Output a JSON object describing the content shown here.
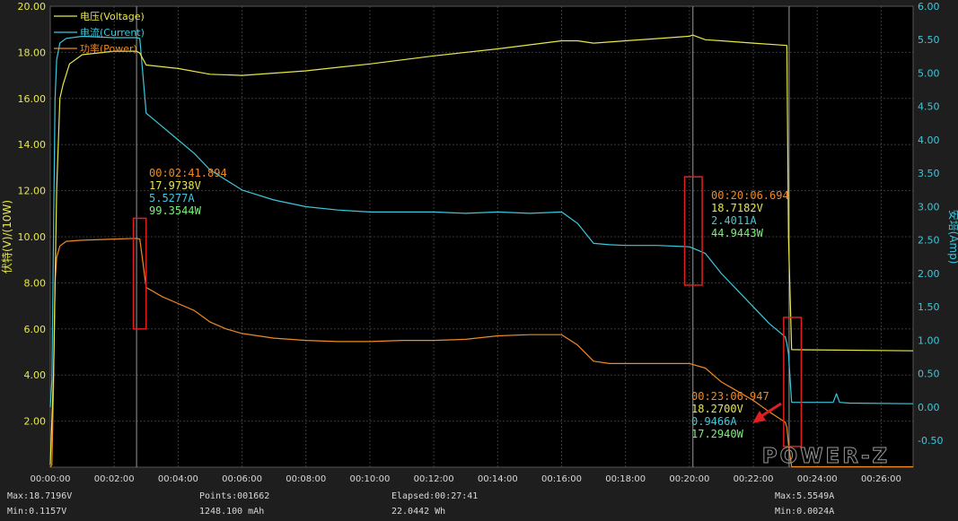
{
  "chart_data": {
    "type": "line",
    "ylabel_left": "伏特(V)/(10W)",
    "ylabel_right": "安培(Amp)",
    "y_left_lim": [
      0,
      20
    ],
    "y_left_ticks": [
      "2.00",
      "4.00",
      "6.00",
      "8.00",
      "10.00",
      "12.00",
      "14.00",
      "16.00",
      "18.00",
      "20.00"
    ],
    "y_right_lim": [
      -0.9,
      6.0
    ],
    "y_right_ticks": [
      "-0.50",
      "0.00",
      "0.50",
      "1.00",
      "1.50",
      "2.00",
      "2.50",
      "3.00",
      "3.50",
      "4.00",
      "4.50",
      "5.00",
      "5.50",
      "6.00"
    ],
    "x_lim_minutes": [
      0,
      27
    ],
    "x_ticks": [
      "00:00:00",
      "00:02:00",
      "00:04:00",
      "00:06:00",
      "00:08:00",
      "00:10:00",
      "00:12:00",
      "00:14:00",
      "00:16:00",
      "00:18:00",
      "00:20:00",
      "00:22:00",
      "00:24:00",
      "00:26:00"
    ],
    "grid": true,
    "legend_position": "top-left",
    "legend": [
      "电压(Voltage)",
      "电流(Current)",
      "功率(Power)"
    ],
    "colors": {
      "voltage": "#e8e84a",
      "current": "#3cc8dc",
      "power": "#f08a24"
    },
    "series": [
      {
        "name": "电压(Voltage)",
        "axis": "left",
        "color": "#e8e84a",
        "x": [
          0,
          0.1,
          0.2,
          0.3,
          0.4,
          0.6,
          1.0,
          2.0,
          2.7,
          2.8,
          3.0,
          4.0,
          5.0,
          6.0,
          8.0,
          10.0,
          12.0,
          14.0,
          16.0,
          16.5,
          17.0,
          18.0,
          19.0,
          20.0,
          20.1,
          20.5,
          21.0,
          22.0,
          23.05,
          23.1,
          23.2,
          27.0
        ],
        "y": [
          0.1,
          4.0,
          12.0,
          16.0,
          16.6,
          17.5,
          17.9,
          18.05,
          18.05,
          17.97,
          17.45,
          17.3,
          17.05,
          17.0,
          17.2,
          17.5,
          17.85,
          18.15,
          18.5,
          18.5,
          18.4,
          18.5,
          18.6,
          18.7,
          18.75,
          18.55,
          18.5,
          18.4,
          18.3,
          10.0,
          5.1,
          5.05
        ]
      },
      {
        "name": "电流(Current)",
        "axis": "right",
        "color": "#3cc8dc",
        "x": [
          0,
          0.05,
          0.1,
          0.15,
          0.2,
          0.3,
          0.5,
          1.0,
          2.0,
          2.7,
          2.8,
          3.0,
          3.5,
          4.0,
          4.5,
          5.0,
          5.5,
          6.0,
          7.0,
          8.0,
          9.0,
          10.0,
          11.0,
          12.0,
          13.0,
          14.0,
          15.0,
          16.0,
          16.5,
          17.0,
          17.5,
          18.0,
          19.0,
          20.0,
          20.5,
          21.0,
          21.5,
          22.0,
          22.5,
          23.0,
          23.05,
          23.1,
          23.2,
          24.5,
          24.6,
          24.7,
          25.0,
          27.0
        ],
        "y": [
          0.0,
          0.4,
          2.6,
          4.6,
          5.2,
          5.45,
          5.52,
          5.55,
          5.53,
          5.53,
          5.52,
          4.4,
          4.2,
          4.0,
          3.8,
          3.55,
          3.4,
          3.25,
          3.1,
          3.0,
          2.95,
          2.92,
          2.92,
          2.92,
          2.9,
          2.92,
          2.9,
          2.92,
          2.75,
          2.45,
          2.43,
          2.42,
          2.42,
          2.4,
          2.3,
          2.0,
          1.75,
          1.5,
          1.25,
          1.05,
          0.95,
          0.8,
          0.07,
          0.07,
          0.2,
          0.07,
          0.06,
          0.05
        ]
      },
      {
        "name": "功率(Power)",
        "axis": "left",
        "color": "#f08a24",
        "x": [
          0,
          0.05,
          0.1,
          0.15,
          0.2,
          0.3,
          0.5,
          1.0,
          2.0,
          2.7,
          2.8,
          3.0,
          3.5,
          4.0,
          4.5,
          5.0,
          5.5,
          6.0,
          7.0,
          8.0,
          9.0,
          10.0,
          11.0,
          12.0,
          13.0,
          14.0,
          15.0,
          16.0,
          16.5,
          17.0,
          17.5,
          18.0,
          19.0,
          20.0,
          20.5,
          21.0,
          21.5,
          22.0,
          22.5,
          23.0,
          23.05,
          23.1,
          23.2,
          27.0
        ],
        "y": [
          0.0,
          0.1,
          3.5,
          8.0,
          9.1,
          9.6,
          9.8,
          9.85,
          9.9,
          9.93,
          9.9,
          7.8,
          7.4,
          7.1,
          6.8,
          6.3,
          6.0,
          5.8,
          5.6,
          5.5,
          5.45,
          5.45,
          5.5,
          5.5,
          5.55,
          5.7,
          5.75,
          5.75,
          5.3,
          4.6,
          4.5,
          4.5,
          4.5,
          4.5,
          4.3,
          3.7,
          3.3,
          2.9,
          2.4,
          1.95,
          1.73,
          1.0,
          0.02,
          0.02
        ]
      }
    ],
    "annotations": [
      {
        "time": "00:02:41.894",
        "voltage": "17.9738V",
        "current": "5.5277A",
        "power": "99.3544W",
        "marker_minute": 2.7,
        "box_left": [
          9.9,
          6.0
        ],
        "box_right_lower": 10.9
      },
      {
        "time": "00:20:06.694",
        "voltage": "18.7182V",
        "current": "2.4011A",
        "power": "44.9443W",
        "marker_minute": 20.11
      },
      {
        "time": "00:23:06.947",
        "voltage": "18.2700V",
        "current": "0.9466A",
        "power": "17.2940W",
        "marker_minute": 23.12
      }
    ]
  },
  "watermark": "POWER-Z",
  "stats": {
    "max_voltage": "Max:18.7196V",
    "min_voltage": "Min:0.1157V",
    "points": "Points:001662",
    "capacity": "1248.100 mAh",
    "elapsed": "Elapsed:00:27:41",
    "energy": "22.0442 Wh",
    "max_current": "Max:5.5549A",
    "min_current": "Min:0.0024A"
  }
}
